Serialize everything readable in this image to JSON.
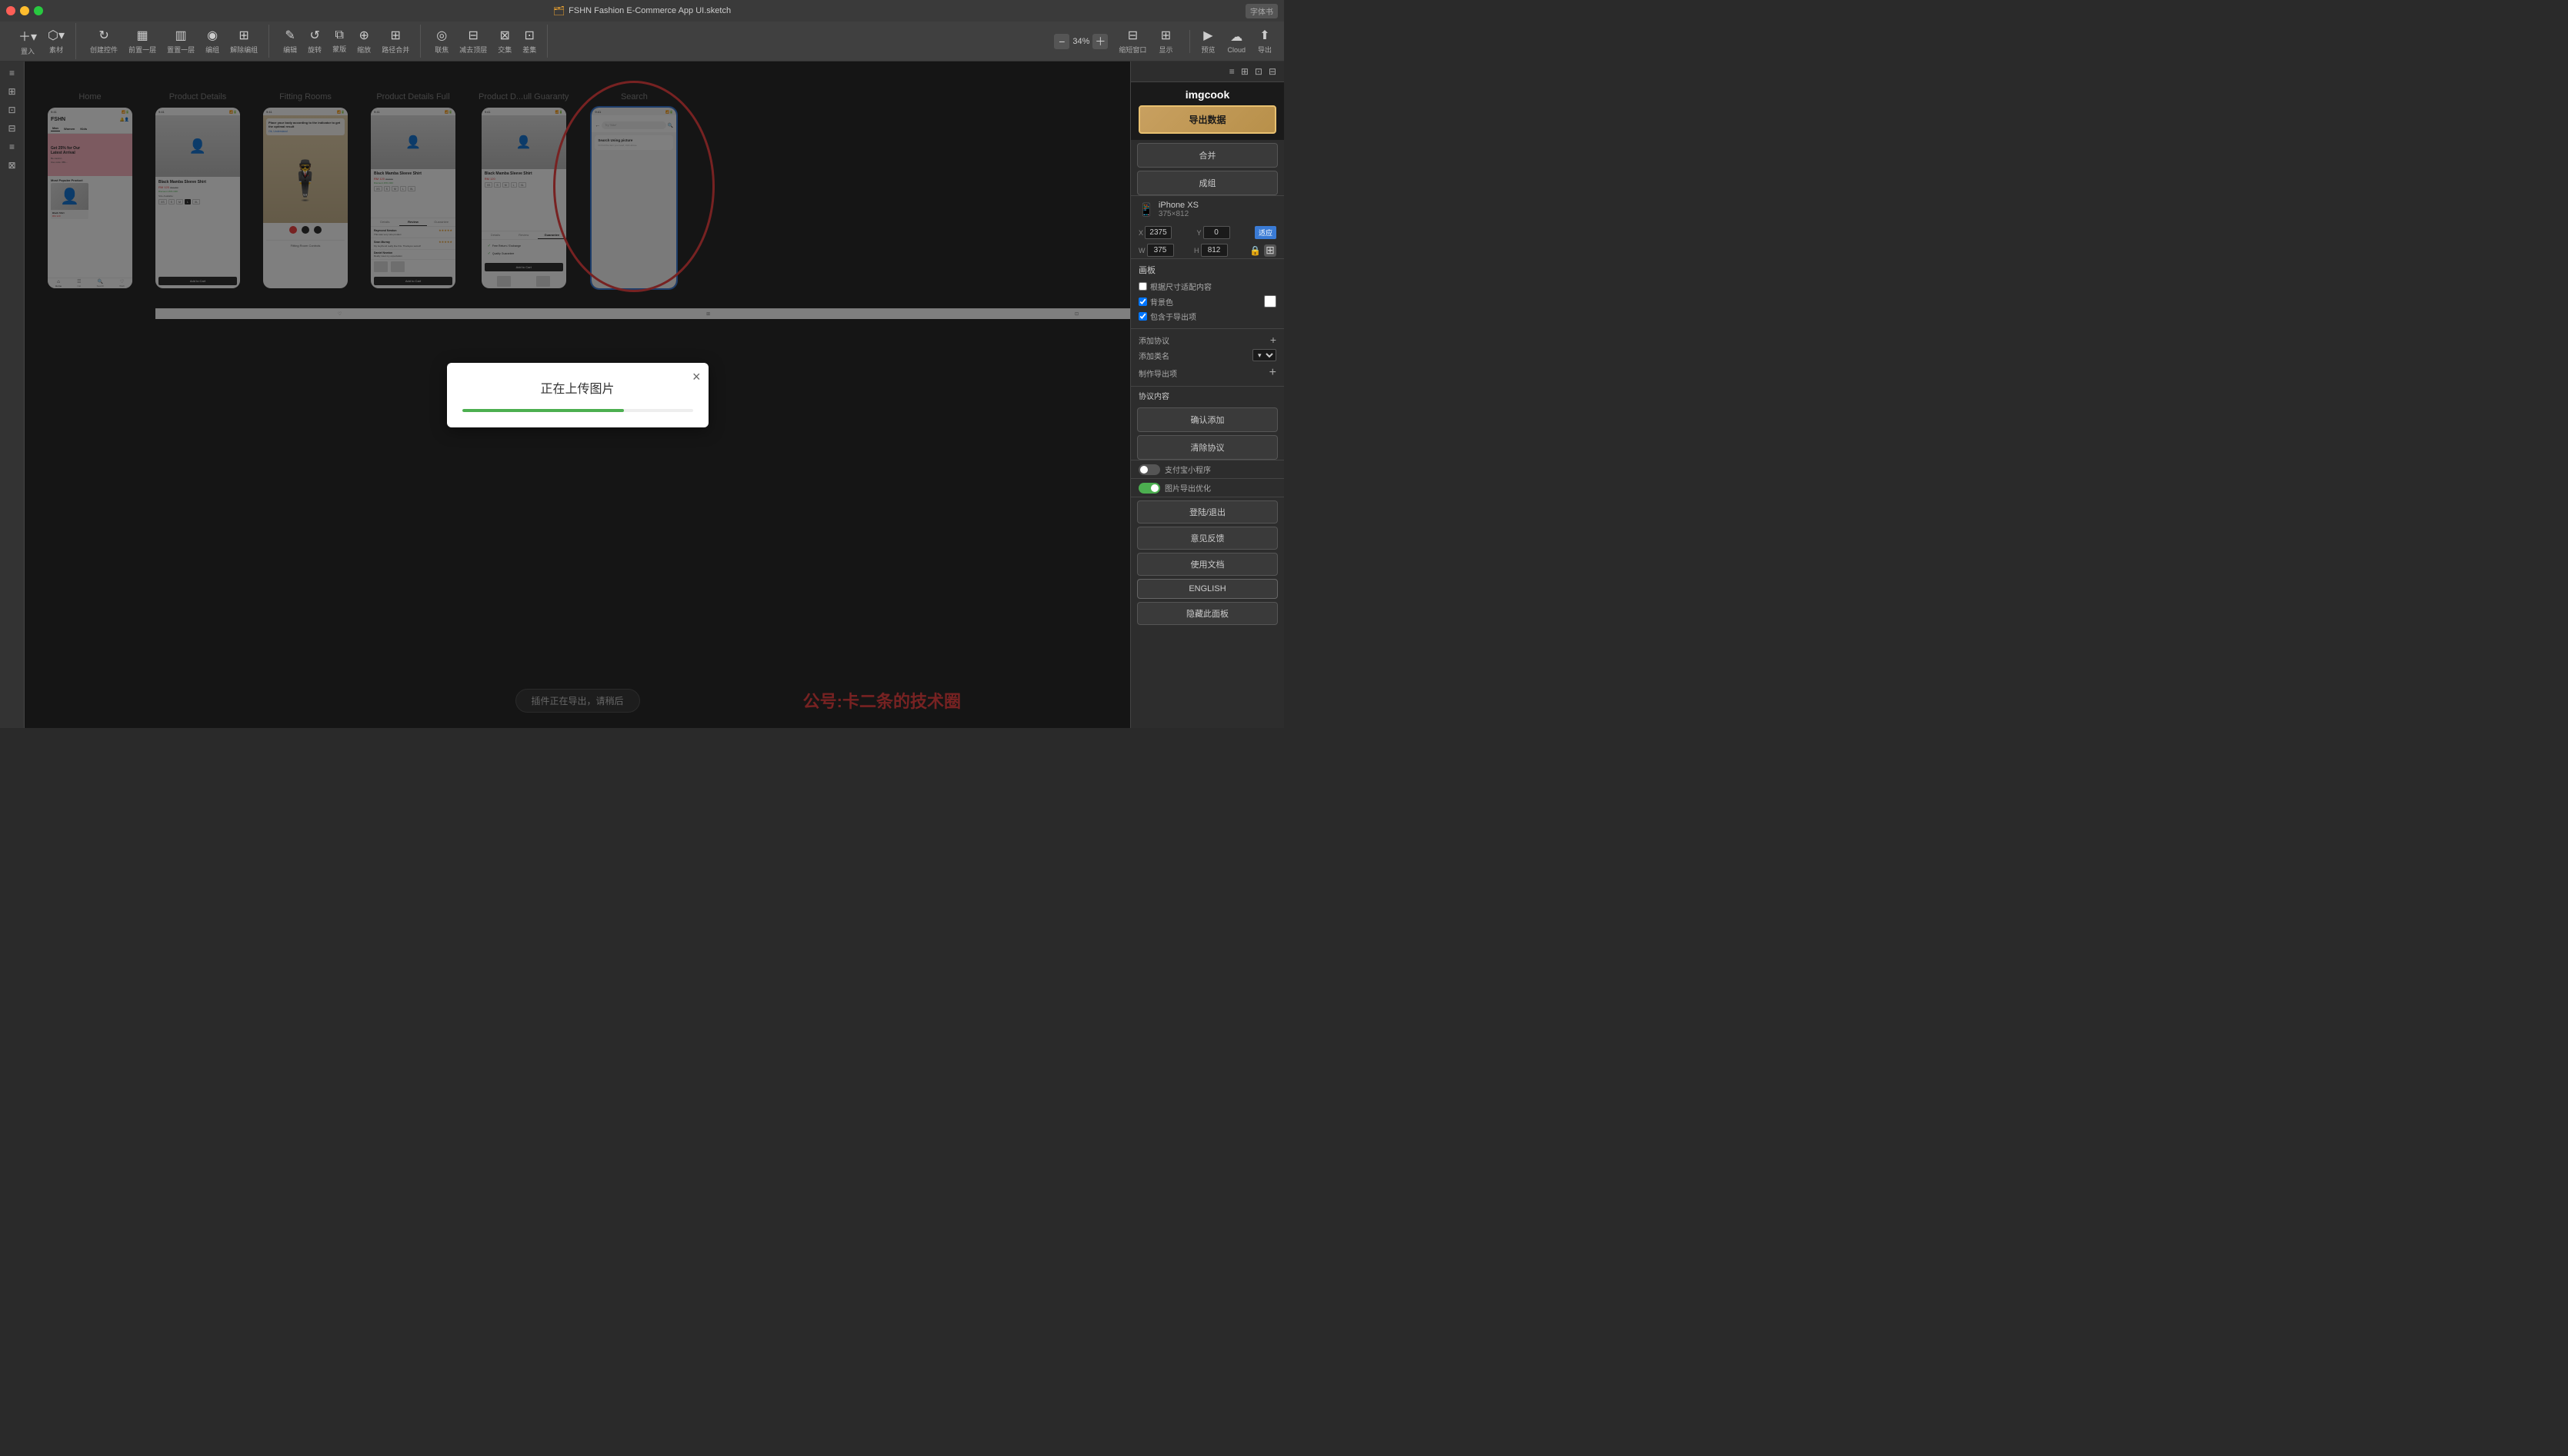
{
  "titleBar": {
    "title": "FSHN Fashion E-Commerce App UI.sketch",
    "trafficLights": [
      "red",
      "yellow",
      "green"
    ],
    "fontBtn": "字体书"
  },
  "toolbar": {
    "groups": [
      {
        "items": [
          {
            "icon": "＋",
            "label": "置入",
            "name": "insert-tool"
          },
          {
            "icon": "⬡",
            "label": "素材",
            "name": "assets-tool"
          }
        ]
      },
      {
        "items": [
          {
            "icon": "↻",
            "label": "创建控件",
            "name": "create-component"
          },
          {
            "icon": "▦",
            "label": "前置一层",
            "name": "forward"
          },
          {
            "icon": "▥",
            "label": "置置一层",
            "name": "backward"
          },
          {
            "icon": "◉",
            "label": "编组",
            "name": "group"
          },
          {
            "icon": "⊞",
            "label": "解除编组",
            "name": "ungroup"
          }
        ]
      },
      {
        "items": [
          {
            "icon": "✎",
            "label": "编辑",
            "name": "edit-tool"
          },
          {
            "icon": "↺",
            "label": "旋转",
            "name": "rotate-tool"
          },
          {
            "icon": "⧉",
            "label": "蒙版",
            "name": "mask-tool"
          },
          {
            "icon": "⊕",
            "label": "缩放",
            "name": "zoom-tool"
          },
          {
            "icon": "⊞",
            "label": "路径合并",
            "name": "path-combine"
          }
        ]
      },
      {
        "items": [
          {
            "icon": "◎",
            "label": "联焦",
            "name": "focus-tool"
          },
          {
            "icon": "⊟",
            "label": "减去顶层",
            "name": "subtract-tool"
          },
          {
            "icon": "⊠",
            "label": "交集",
            "name": "intersect-tool"
          },
          {
            "icon": "⊡",
            "label": "差集",
            "name": "difference-tool"
          }
        ]
      }
    ],
    "zoom": {
      "value": "34%",
      "decreaseLabel": "−",
      "increaseLabel": "＋"
    },
    "rightTools": [
      {
        "icon": "▶",
        "label": "预览",
        "name": "preview-tool"
      },
      {
        "icon": "☁",
        "label": "Cloud",
        "name": "cloud-tool"
      },
      {
        "icon": "⬆",
        "label": "导出",
        "name": "export-tool"
      }
    ]
  },
  "artboards": [
    {
      "label": "Home",
      "type": "home",
      "name": "artboard-home"
    },
    {
      "label": "Product Details",
      "type": "product-details",
      "name": "artboard-product-details"
    },
    {
      "label": "Fitting Rooms",
      "type": "fitting-rooms",
      "name": "artboard-fitting-rooms"
    },
    {
      "label": "Product Details Full",
      "type": "product-full",
      "name": "artboard-product-full"
    },
    {
      "label": "Product D...ull Guaranty",
      "type": "guarantee",
      "name": "artboard-guarantee"
    },
    {
      "label": "Search",
      "type": "search",
      "name": "artboard-search",
      "selected": true
    }
  ],
  "dialog": {
    "title": "正在上传图片",
    "progressValue": 70,
    "closeLabel": "×"
  },
  "statusBar": {
    "text": "插件正在导出，请稍后"
  },
  "watermark": "公号:卡二条的技术圈",
  "rightPanel": {
    "imgcookLogo": "imgcook",
    "exportDataBtn": "导出数据",
    "mergeBtn": "合并",
    "groupBtn": "成组",
    "device": {
      "name": "iPhone XS",
      "size": "375×812"
    },
    "coords": {
      "xLabel": "X",
      "xValue": "2375",
      "yLabel": "Y",
      "yValue": "0",
      "adaptLabel": "适应"
    },
    "sizes": {
      "wLabel": "W",
      "wValue": "375",
      "hLabel": "H",
      "hValue": "812"
    },
    "canvas": {
      "title": "画板",
      "adaptContent": "根据尺寸适配内容",
      "bgColor": "背景色",
      "includeExport": "包含于导出项"
    },
    "protocol": {
      "addProtocol": "添加协议",
      "addCategory": "添加类名",
      "makeExportItem": "制作导出项",
      "protocolContent": "协议内容",
      "confirmAdd": "确认添加",
      "clearProtocol": "清除协议"
    },
    "toggles": [
      {
        "label": "支付宝小程序",
        "on": false,
        "name": "alipay-toggle"
      },
      {
        "label": "图片导出优化",
        "on": true,
        "name": "image-export-toggle"
      }
    ],
    "actions": [
      {
        "label": "登陆/退出",
        "name": "login-logout-btn"
      },
      {
        "label": "意见反馈",
        "name": "feedback-btn"
      },
      {
        "label": "使用文档",
        "name": "docs-btn"
      },
      {
        "label": "ENGLISH",
        "name": "english-btn"
      },
      {
        "label": "隐藏此面板",
        "name": "hide-panel-btn"
      }
    ]
  },
  "searchScreen": {
    "searchPlaceholder": "Try \"Nike\"",
    "usingPictureLabel": "Search Using picture",
    "uploadText": "Or find the item you need, click above"
  }
}
